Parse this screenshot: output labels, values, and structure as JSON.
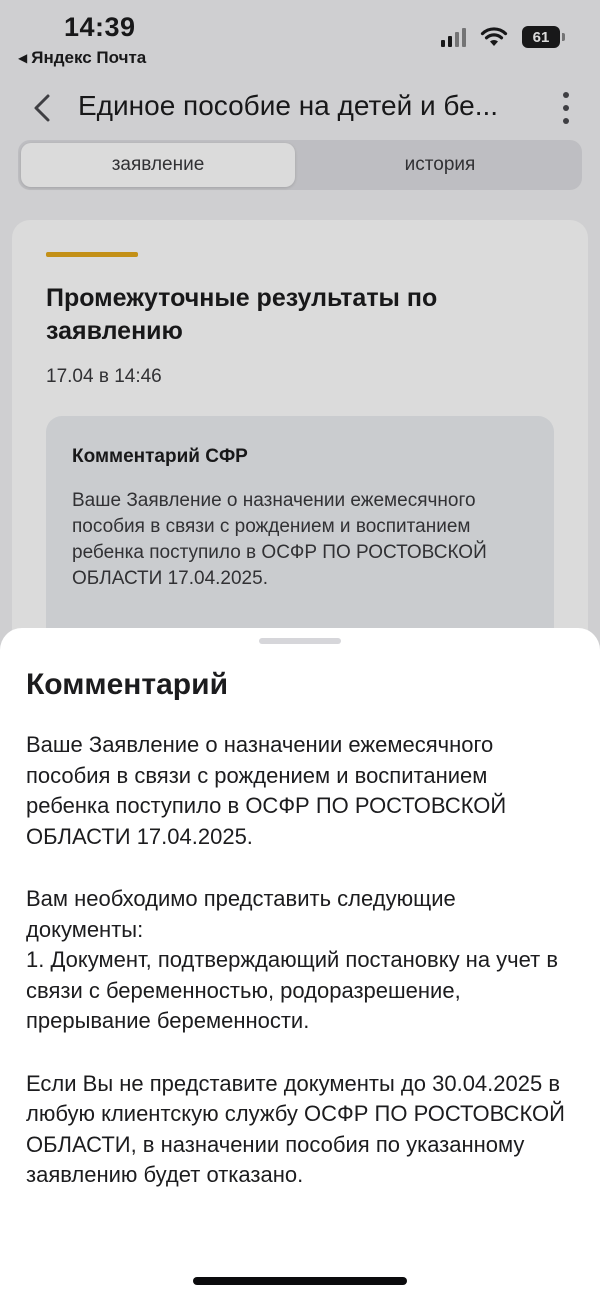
{
  "status_bar": {
    "time": "14:39",
    "back_app": "Яндекс Почта",
    "battery": "61"
  },
  "nav": {
    "title": "Единое пособие на детей и бе..."
  },
  "tabs": [
    {
      "label": "заявление",
      "active": true
    },
    {
      "label": "история",
      "active": false
    }
  ],
  "card": {
    "title": "Промежуточные результаты по заявлению",
    "date": "17.04 в 14:46",
    "comment_title": "Комментарий СФР",
    "comment_text": "Ваше Заявление о назначении ежемесячного пособия в связи с рождением и воспитанием ребенка поступило в ОСФР ПО РОСТОВСКОЙ ОБЛАСТИ 17.04.2025."
  },
  "sheet": {
    "title": "Комментарий",
    "paragraphs": [
      "Ваше Заявление о назначении ежемесячного пособия в связи с рождением и воспитанием ребенка поступило в ОСФР ПО РОСТОВСКОЙ ОБЛАСТИ 17.04.2025.",
      "Вам необходимо представить следующие документы:\n1. Документ, подтверждающий постановку на учет в связи с беременностью, родоразрешение, прерывание беременности.",
      "Если Вы не представите документы до 30.04.2025 в любую клиентскую службу ОСФР ПО РОСТОВСКОЙ ОБЛАСТИ, в назначении пособия по указанному заявлению будет отказано."
    ]
  },
  "colors": {
    "accent": "#e3a81b"
  }
}
